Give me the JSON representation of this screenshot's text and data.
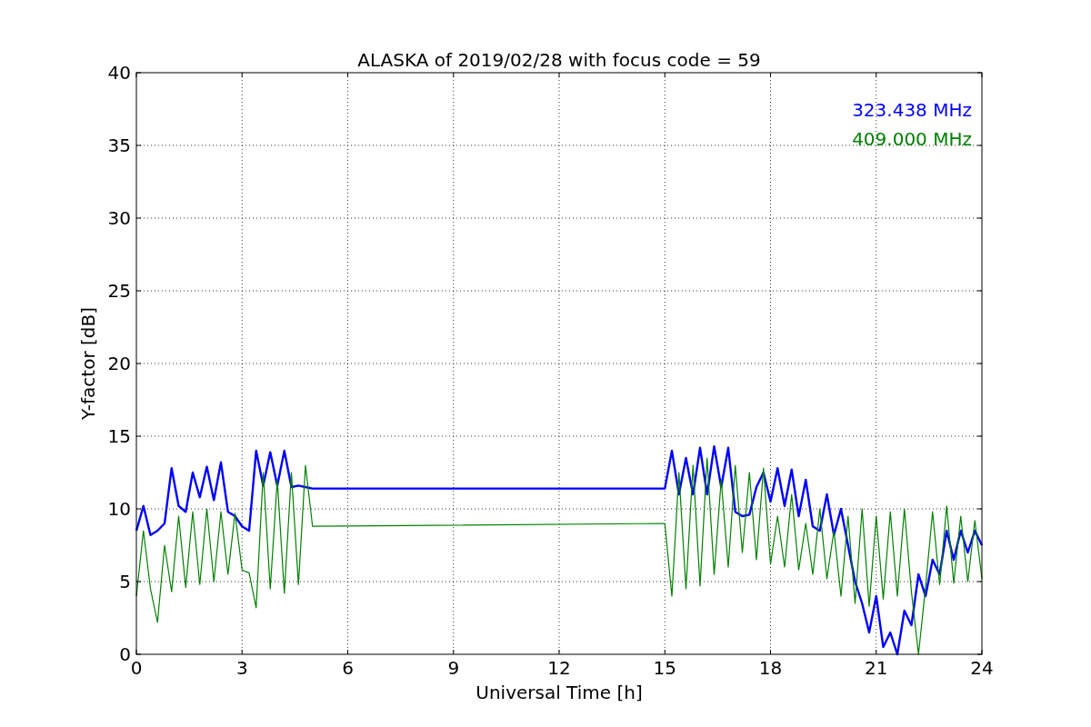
{
  "chart_data": {
    "type": "line",
    "title": "ALASKA of 2019/02/28 with focus code = 59",
    "xlabel": "Universal Time [h]",
    "ylabel": "Y-factor [dB]",
    "x": [
      0,
      0.2,
      0.4,
      0.6,
      0.8,
      1.0,
      1.2,
      1.4,
      1.6,
      1.8,
      2.0,
      2.2,
      2.4,
      2.6,
      2.8,
      3.0,
      3.2,
      3.4,
      3.6,
      3.8,
      4.0,
      4.2,
      4.4,
      4.6,
      4.8,
      5.0,
      15.0,
      15.2,
      15.4,
      15.6,
      15.8,
      16.0,
      16.2,
      16.4,
      16.6,
      16.8,
      17.0,
      17.2,
      17.4,
      17.6,
      17.8,
      18.0,
      18.2,
      18.4,
      18.6,
      18.8,
      19.0,
      19.2,
      19.4,
      19.6,
      19.8,
      20.0,
      20.2,
      20.4,
      20.6,
      20.8,
      21.0,
      21.2,
      21.4,
      21.6,
      21.8,
      22.0,
      22.2,
      22.4,
      22.6,
      22.8,
      23.0,
      23.2,
      23.4,
      23.6,
      23.8,
      24.0
    ],
    "series": [
      {
        "name": "323.438 MHz",
        "color": "#0000ff",
        "values": [
          8.5,
          10.2,
          8.2,
          8.5,
          9.0,
          12.8,
          10.2,
          9.8,
          12.5,
          10.8,
          12.9,
          10.6,
          13.2,
          9.8,
          9.5,
          8.8,
          8.5,
          14.0,
          11.6,
          13.9,
          11.6,
          14.0,
          11.5,
          11.6,
          11.5,
          11.4,
          11.4,
          14.0,
          11.0,
          13.5,
          11.0,
          14.2,
          11.0,
          14.3,
          11.5,
          14.2,
          9.8,
          9.5,
          9.6,
          11.5,
          12.5,
          10.5,
          12.8,
          10.2,
          12.7,
          9.5,
          12.0,
          8.8,
          8.5,
          11.0,
          8.2,
          10.0,
          7.5,
          5.0,
          3.5,
          1.5,
          4.0,
          0.5,
          1.5,
          0.0,
          3.0,
          2.0,
          5.5,
          4.0,
          6.5,
          5.5,
          8.5,
          6.5,
          8.5,
          7.0,
          8.5,
          7.5
        ]
      },
      {
        "name": "409.000 MHz",
        "color": "#008000",
        "values": [
          4.0,
          8.5,
          4.5,
          2.2,
          7.5,
          4.3,
          9.5,
          4.6,
          9.8,
          4.8,
          10.0,
          5.0,
          9.8,
          5.5,
          9.7,
          5.8,
          5.6,
          3.2,
          12.5,
          4.5,
          12.0,
          4.2,
          12.5,
          4.8,
          13.0,
          8.8,
          9.0,
          4.0,
          12.5,
          4.5,
          13.0,
          4.7,
          13.5,
          5.5,
          12.0,
          6.0,
          13.0,
          7.0,
          12.5,
          6.5,
          12.8,
          6.2,
          9.5,
          6.0,
          11.0,
          5.8,
          9.0,
          5.5,
          10.0,
          5.2,
          8.5,
          4.0,
          9.5,
          3.5,
          10.0,
          3.3,
          9.5,
          3.8,
          9.8,
          4.0,
          10.0,
          4.3,
          0.0,
          4.6,
          9.8,
          4.8,
          10.2,
          4.9,
          9.5,
          5.0,
          9.2,
          5.2
        ]
      }
    ],
    "grid": true,
    "xlim": [
      0,
      24
    ],
    "ylim": [
      0,
      40
    ],
    "xticks": [
      0,
      3,
      6,
      9,
      12,
      15,
      18,
      21,
      24
    ],
    "yticks": [
      0,
      5,
      10,
      15,
      20,
      25,
      30,
      35,
      40
    ]
  }
}
